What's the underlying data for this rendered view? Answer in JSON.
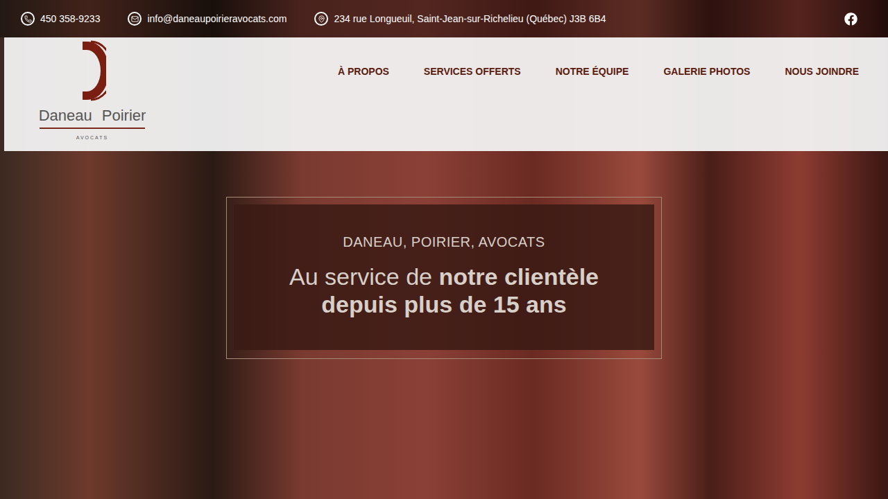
{
  "contact": {
    "phone": "450 358-9233",
    "email": "info@daneaupoirieravocats.com",
    "address": "234 rue Longueuil, Saint-Jean-sur-Richelieu (Québec) J3B 6B4"
  },
  "logo": {
    "name": "Daneau Poirier",
    "tagline": "AVOCATS"
  },
  "nav": [
    {
      "label": "À PROPOS",
      "selected": false
    },
    {
      "label": "SERVICES OFFERTS",
      "selected": false
    },
    {
      "label": "NOTRE ÉQUIPE",
      "selected": false
    },
    {
      "label": "GALERIE PHOTOS",
      "selected": false
    },
    {
      "label": "NOUS JOINDRE",
      "selected": false
    }
  ],
  "banner": {
    "eyebrow": "DANEAU, POIRIER, AVOCATS",
    "lead": "Au service de ",
    "highlight": "notre clientèle",
    "line2": "depuis plus de 15 ans"
  }
}
